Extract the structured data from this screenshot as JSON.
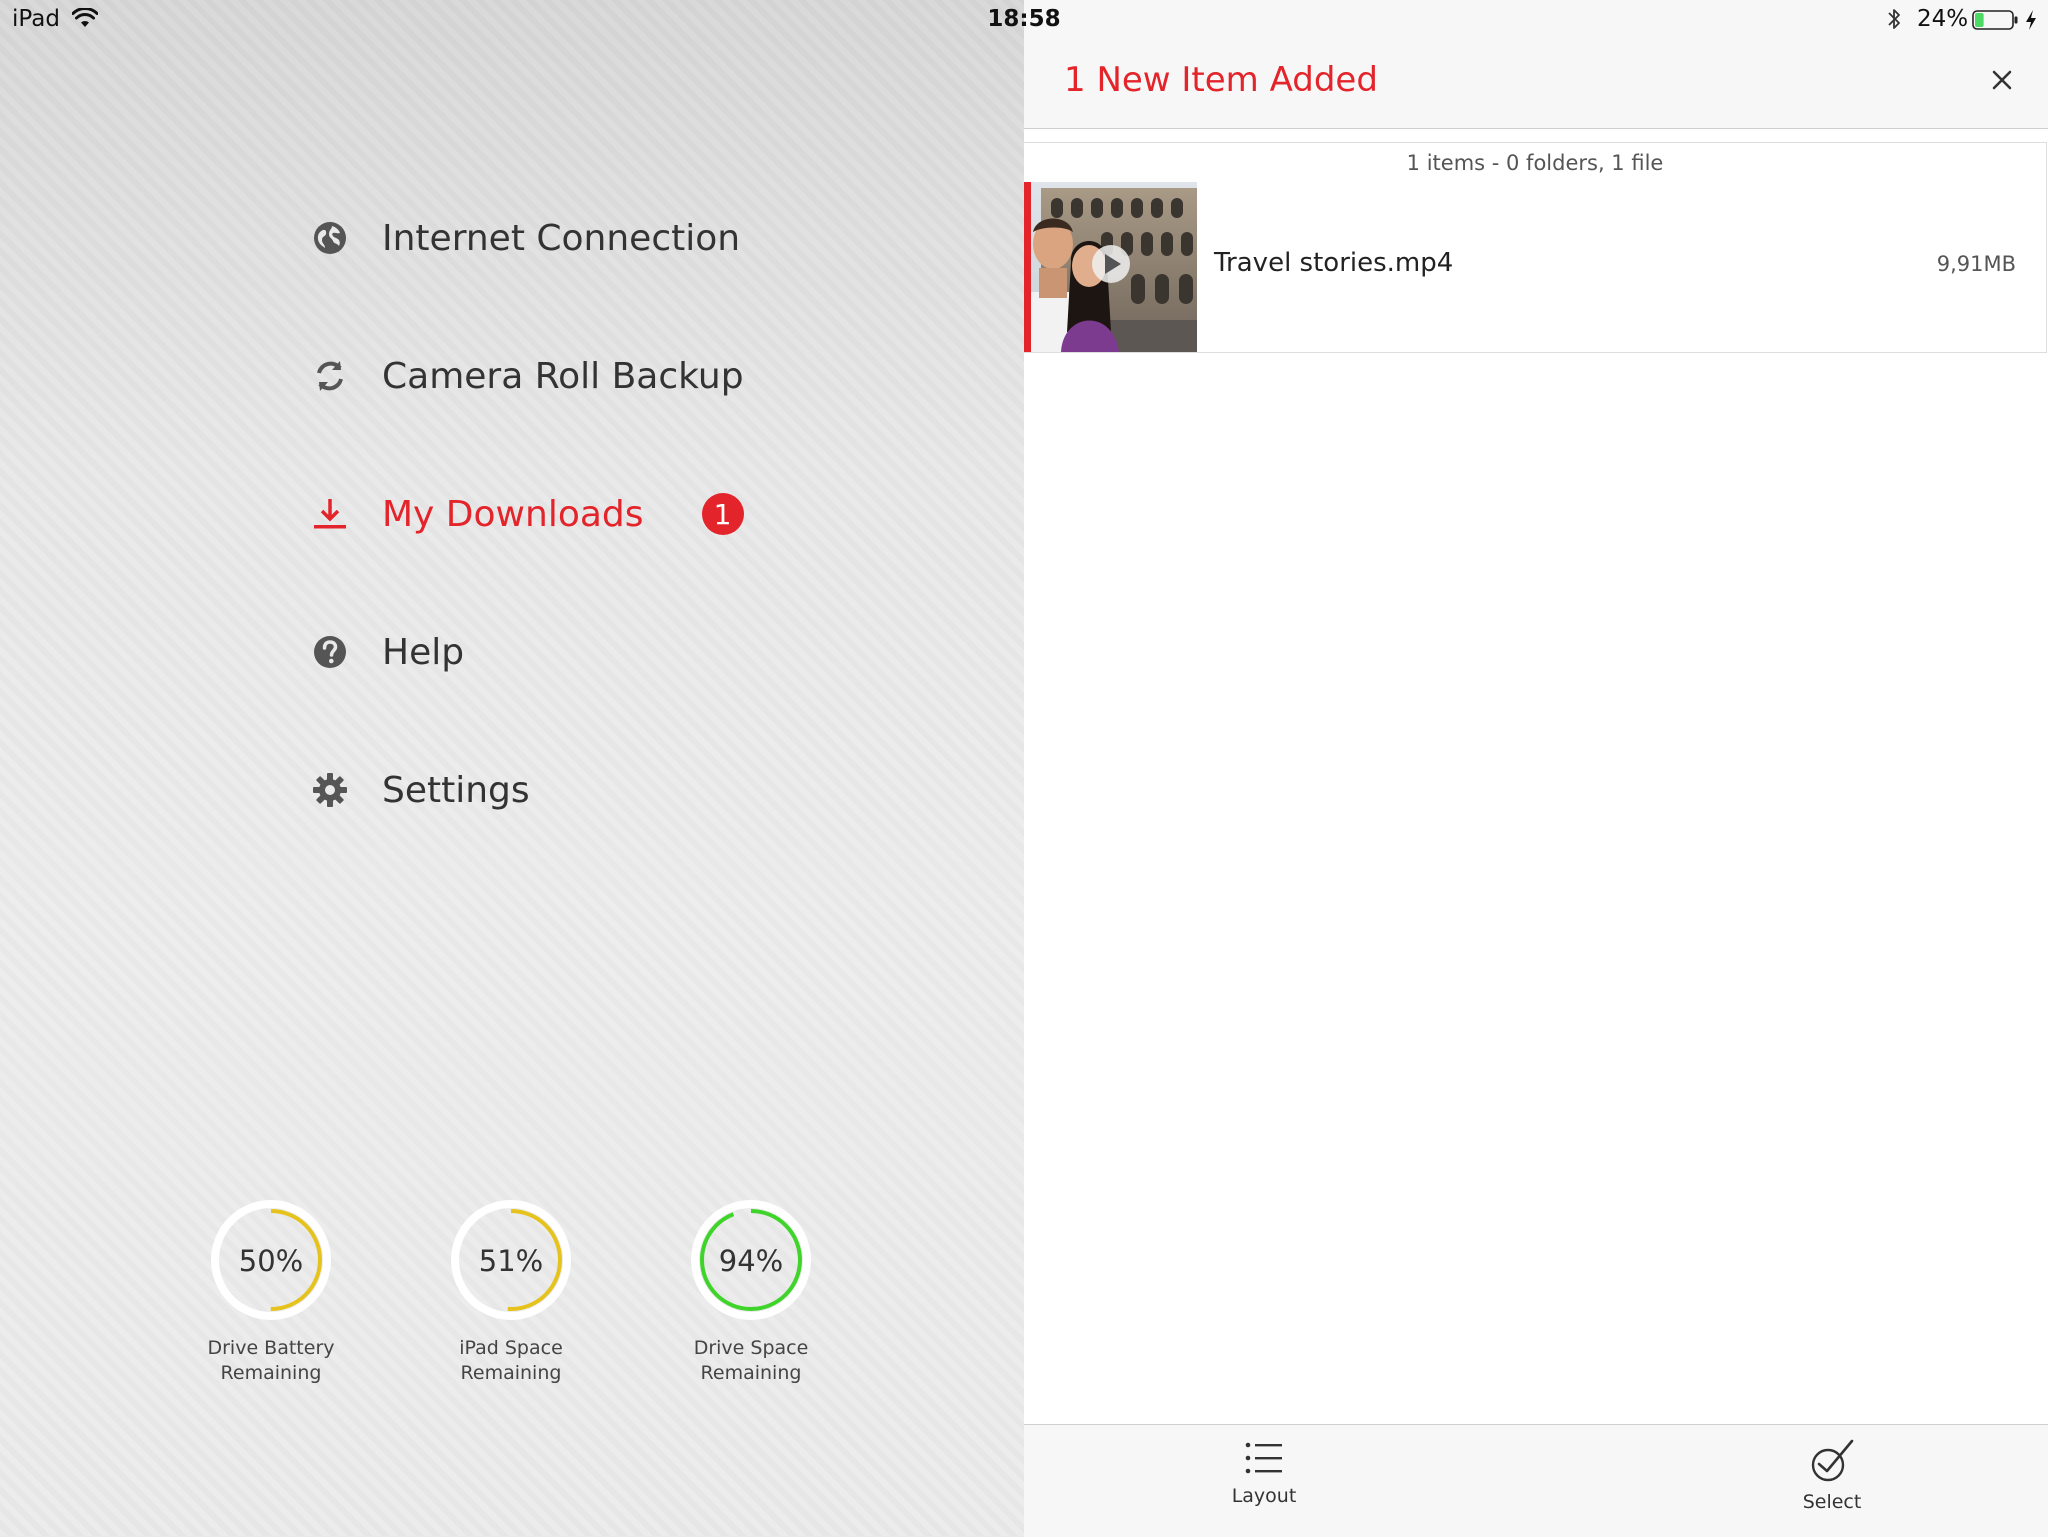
{
  "status_bar": {
    "device": "iPad",
    "time": "18:58",
    "battery_percent": "24%",
    "battery_level": 0.24
  },
  "menu": {
    "items": [
      {
        "label": "Internet Connection",
        "icon": "globe-icon",
        "active": false
      },
      {
        "label": "Camera Roll Backup",
        "icon": "sync-icon",
        "active": false
      },
      {
        "label": "My Downloads",
        "icon": "download-icon",
        "active": true,
        "badge": "1"
      },
      {
        "label": "Help",
        "icon": "help-icon",
        "active": false
      },
      {
        "label": "Settings",
        "icon": "gear-icon",
        "active": false
      }
    ]
  },
  "gauges": [
    {
      "value_text": "50%",
      "value": 50,
      "label_line1": "Drive Battery",
      "label_line2": "Remaining",
      "color": "#e6c21d"
    },
    {
      "value_text": "51%",
      "value": 51,
      "label_line1": "iPad Space",
      "label_line2": "Remaining",
      "color": "#e6c21d"
    },
    {
      "value_text": "94%",
      "value": 94,
      "label_line1": "Drive Space",
      "label_line2": "Remaining",
      "color": "#3ed42a"
    }
  ],
  "content": {
    "title": "1 New Item Added",
    "summary": "1 items - 0 folders, 1 file",
    "files": [
      {
        "name": "Travel stories.mp4",
        "size": "9,91MB",
        "type": "video"
      }
    ]
  },
  "toolbar": {
    "layout_label": "Layout",
    "select_label": "Select"
  },
  "colors": {
    "accent": "#e3242b",
    "battery_fill": "#4cd964",
    "gauge_track": "#ffffff"
  }
}
